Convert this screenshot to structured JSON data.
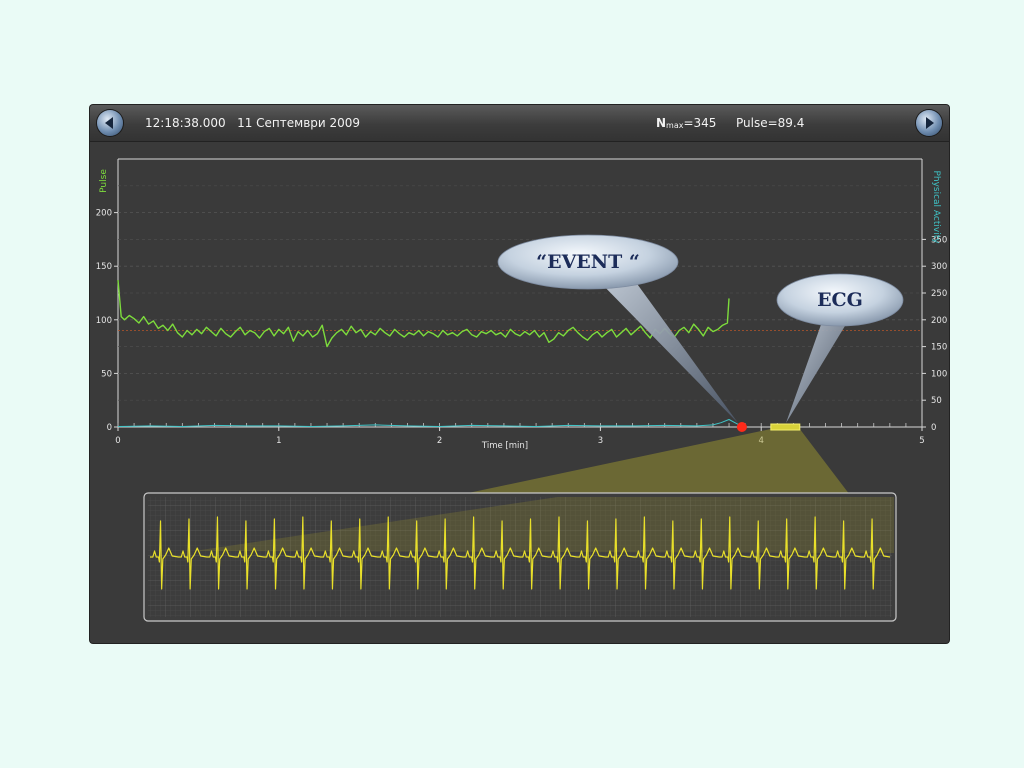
{
  "header": {
    "timestamp": "12:18:38.000",
    "date": "11 Септември 2009",
    "nmax_prefix": "N",
    "nmax_sub": "max",
    "nmax_value": "=345",
    "pulse_text": "Pulse=89.4"
  },
  "callouts": {
    "event": "“EVENT “",
    "ecg": "ECG"
  },
  "icons": {
    "prev": "arrow-left-icon",
    "next": "arrow-right-icon"
  },
  "colors": {
    "pulse_line": "#7ddc3c",
    "activity_line": "#3fc3c6",
    "ecg_line": "#e9e02a",
    "event_marker": "#ff2a1a",
    "reference_line": "#b5562a"
  },
  "chart_data": [
    {
      "type": "line",
      "title": "",
      "xlabel": "Time [min]",
      "ylabel": "Pulse",
      "y2label": "Physical Activity",
      "xlim": [
        0,
        5
      ],
      "ylim": [
        0,
        250
      ],
      "y2lim": [
        0,
        500
      ],
      "xticks": [
        0,
        1,
        2,
        3,
        4,
        5
      ],
      "yticks": [
        0,
        50,
        100,
        150,
        200
      ],
      "y2ticks": [
        0,
        50,
        100,
        150,
        200,
        250,
        300,
        350
      ],
      "reference_line_y": 90,
      "event_marker_x": 3.88,
      "ecg_window_x": [
        4.06,
        4.24
      ],
      "series": [
        {
          "name": "Pulse",
          "axis": "left",
          "x": [
            0,
            0.02,
            0.04,
            0.07,
            0.1,
            0.13,
            0.16,
            0.19,
            0.22,
            0.25,
            0.28,
            0.31,
            0.34,
            0.37,
            0.4,
            0.43,
            0.46,
            0.49,
            0.52,
            0.55,
            0.58,
            0.61,
            0.64,
            0.67,
            0.7,
            0.73,
            0.76,
            0.79,
            0.82,
            0.85,
            0.88,
            0.91,
            0.94,
            0.97,
            1.0,
            1.03,
            1.06,
            1.09,
            1.12,
            1.15,
            1.18,
            1.21,
            1.24,
            1.27,
            1.3,
            1.33,
            1.36,
            1.39,
            1.42,
            1.45,
            1.48,
            1.51,
            1.54,
            1.57,
            1.6,
            1.63,
            1.66,
            1.69,
            1.72,
            1.75,
            1.78,
            1.81,
            1.84,
            1.87,
            1.9,
            1.93,
            1.96,
            1.99,
            2.02,
            2.05,
            2.08,
            2.11,
            2.14,
            2.17,
            2.2,
            2.23,
            2.26,
            2.29,
            2.32,
            2.35,
            2.38,
            2.41,
            2.44,
            2.47,
            2.5,
            2.53,
            2.56,
            2.59,
            2.62,
            2.65,
            2.68,
            2.71,
            2.74,
            2.77,
            2.8,
            2.83,
            2.86,
            2.89,
            2.92,
            2.95,
            2.98,
            3.01,
            3.04,
            3.07,
            3.1,
            3.13,
            3.16,
            3.19,
            3.22,
            3.25,
            3.28,
            3.31,
            3.34,
            3.37,
            3.4,
            3.43,
            3.46,
            3.49,
            3.52,
            3.55,
            3.58,
            3.61,
            3.64,
            3.67,
            3.7,
            3.73,
            3.76,
            3.79,
            3.8
          ],
          "values": [
            137,
            103,
            100,
            104,
            101,
            97,
            103,
            96,
            99,
            92,
            95,
            90,
            96,
            88,
            84,
            90,
            86,
            91,
            87,
            93,
            89,
            85,
            92,
            87,
            84,
            89,
            93,
            86,
            90,
            88,
            83,
            89,
            92,
            85,
            91,
            87,
            93,
            80,
            89,
            85,
            90,
            84,
            87,
            95,
            75,
            83,
            88,
            91,
            86,
            94,
            88,
            91,
            84,
            89,
            86,
            92,
            88,
            85,
            91,
            87,
            84,
            88,
            86,
            90,
            85,
            89,
            87,
            84,
            90,
            86,
            88,
            85,
            89,
            91,
            86,
            84,
            89,
            87,
            90,
            86,
            88,
            84,
            91,
            87,
            85,
            89,
            86,
            90,
            84,
            88,
            79,
            82,
            88,
            85,
            90,
            93,
            88,
            84,
            81,
            86,
            89,
            84,
            88,
            91,
            84,
            88,
            92,
            86,
            90,
            94,
            88,
            83,
            91,
            87,
            92,
            87,
            84,
            90,
            93,
            88,
            96,
            91,
            85,
            93,
            89,
            91,
            95,
            97,
            120
          ]
        },
        {
          "name": "Physical Activity",
          "axis": "right",
          "x": [
            0,
            0.2,
            0.4,
            0.6,
            0.8,
            1.0,
            1.2,
            1.4,
            1.6,
            1.8,
            2.0,
            2.2,
            2.4,
            2.6,
            2.8,
            3.0,
            3.2,
            3.4,
            3.6,
            3.7,
            3.75,
            3.8,
            3.85,
            3.88
          ],
          "values": [
            1,
            2,
            1,
            3,
            2,
            2,
            1,
            2,
            4,
            2,
            1,
            3,
            2,
            1,
            3,
            2,
            2,
            3,
            2,
            4,
            8,
            14,
            6,
            2
          ]
        }
      ]
    },
    {
      "type": "line",
      "title": "",
      "series": [
        {
          "name": "ECG",
          "beats": 26
        }
      ]
    }
  ]
}
